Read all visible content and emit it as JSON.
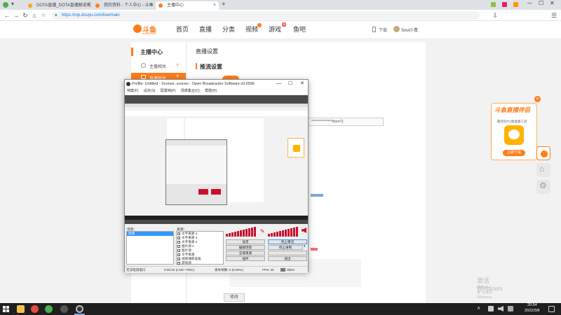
{
  "browser": {
    "tabs": [
      {
        "label": "DOTA直播_DOTA直播解说视",
        "color": "#f5a623",
        "active": false
      },
      {
        "label": "我的资料 - 个人中心 - 斗鱼",
        "color": "#ff7c1a",
        "active": false
      },
      {
        "label": "主播中心",
        "color": "#ff7c1a",
        "active": true
      }
    ],
    "new_tab": "+",
    "url": "https://mp.douyu.com/live/main",
    "window_controls": [
      "—",
      "☐",
      "✕"
    ]
  },
  "site": {
    "logo": "斗鱼",
    "logo_sub": "douyu.com",
    "nav": [
      "首页",
      "直播",
      "分类",
      "视频",
      "游戏",
      "鱼吧"
    ],
    "nav_badge": "新",
    "download": "下载",
    "user": "Soul小青"
  },
  "sidebar": {
    "title": "主播中心",
    "items": [
      {
        "label": "主播相关",
        "active": false
      },
      {
        "label": "直播相关",
        "active": true
      }
    ]
  },
  "content": {
    "section_title": "直播设置",
    "subsection": "推流设置",
    "code_text": "**************8om7)",
    "bottom_button": "修改",
    "watermark_line1": "激活 Windows",
    "watermark_line2": "转到\"设置\"以激活 Windows。"
  },
  "obs": {
    "title": "Profile: Untitled - Scenes: scenes - Open Broadcaster Software v0.659b",
    "menu": [
      "档案(F)",
      "设定(S)",
      "配置档(P)",
      "场景集合(C)",
      "帮助(H)"
    ],
    "scenes_label": "场景：",
    "scenes": [
      "场景"
    ],
    "sources_label": "来源：",
    "sources": [
      {
        "label": "文字来源 4",
        "checked": true
      },
      {
        "label": "文字来源 3",
        "checked": true
      },
      {
        "label": "文字来源 2",
        "checked": true
      },
      {
        "label": "图片源 2",
        "checked": true
      },
      {
        "label": "图片源",
        "checked": true
      },
      {
        "label": "文字来源",
        "checked": true
      },
      {
        "label": "视频捕获设备",
        "checked": true
      },
      {
        "label": "游戏源",
        "checked": true
      }
    ],
    "buttons": {
      "settings": "设定",
      "stop_stream": "停止串流",
      "edit_scene": "编辑场景",
      "stop_record": "停止录制",
      "global_sources": "全域来源",
      "plugins": "插件",
      "exit": "退出"
    },
    "status": {
      "preview_scale": "无法检测窗口",
      "time": "0:00:02 (LIVE • REC)",
      "dropped": "丢失帧数: 0 (0.00%)",
      "fps": "FPS: 30",
      "rate": "0kb/s"
    }
  },
  "promo": {
    "title": "斗鱼直播伴侣",
    "desc": "最佳的PC端直播工具",
    "button": "立即下载",
    "close": "×"
  },
  "taskbar": {
    "time": "20:54",
    "date": "2022/3/8"
  },
  "colors": {
    "brand": "#ff7c1a",
    "obs_meter": "#c8102e",
    "taskbar": "#1f1f1f"
  }
}
